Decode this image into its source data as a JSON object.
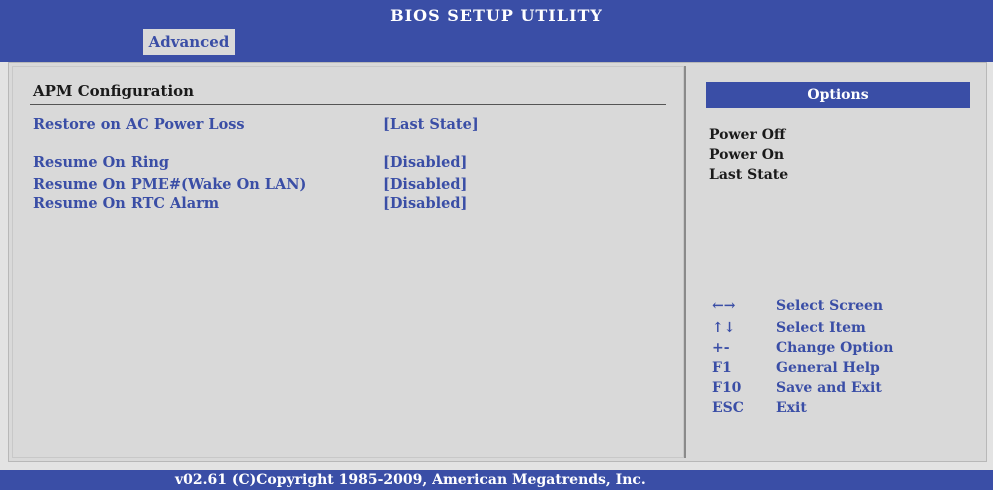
{
  "header": {
    "title": "BIOS SETUP UTILITY",
    "active_tab": "Advanced"
  },
  "main": {
    "section_title": "APM Configuration",
    "items": [
      {
        "label": "Restore on AC Power Loss",
        "value": "[Last State]"
      },
      {
        "label": "Resume On Ring",
        "value": "[Disabled]"
      },
      {
        "label": "Resume On PME#(Wake On LAN)",
        "value": "[Disabled]"
      },
      {
        "label": "Resume On RTC Alarm",
        "value": "[Disabled]"
      }
    ]
  },
  "side": {
    "options_title": "Options",
    "options": [
      "Power Off",
      "Power On",
      "Last State"
    ],
    "help": [
      {
        "key": "←→",
        "text": "Select Screen"
      },
      {
        "key": "↑↓",
        "text": "Select Item"
      },
      {
        "key": "+-",
        "text": "Change Option"
      },
      {
        "key": "F1",
        "text": "General Help"
      },
      {
        "key": "F10",
        "text": "Save and Exit"
      },
      {
        "key": "ESC",
        "text": "Exit"
      }
    ]
  },
  "footer": {
    "text": "v02.61 (C)Copyright 1985-2009, American Megatrends, Inc."
  },
  "colors": {
    "accent_blue": "#3a4ea6",
    "panel_gray": "#d9d9d9"
  }
}
